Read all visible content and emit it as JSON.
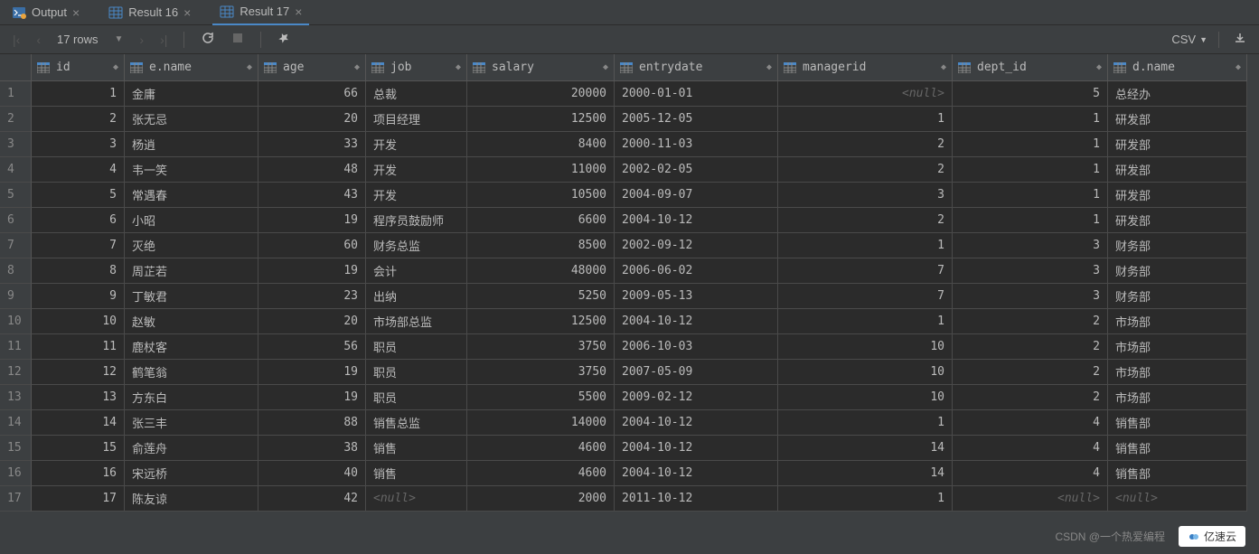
{
  "tabs": [
    {
      "label": "Output",
      "active": false,
      "type": "output"
    },
    {
      "label": "Result 16",
      "active": false,
      "type": "result"
    },
    {
      "label": "Result 17",
      "active": true,
      "type": "result"
    }
  ],
  "toolbar": {
    "rows_label": "17 rows",
    "csv_label": "CSV"
  },
  "columns": [
    {
      "name": "id",
      "align": "num"
    },
    {
      "name": "e.name",
      "align": "text"
    },
    {
      "name": "age",
      "align": "num"
    },
    {
      "name": "job",
      "align": "text"
    },
    {
      "name": "salary",
      "align": "num"
    },
    {
      "name": "entrydate",
      "align": "text"
    },
    {
      "name": "managerid",
      "align": "num"
    },
    {
      "name": "dept_id",
      "align": "num"
    },
    {
      "name": "d.name",
      "align": "text"
    }
  ],
  "rows": [
    {
      "n": "1",
      "id": "1",
      "ename": "金庸",
      "age": "66",
      "job": "总裁",
      "salary": "20000",
      "entrydate": "2000-01-01",
      "managerid": "<null>",
      "managerid_null": true,
      "dept_id": "5",
      "dname": "总经办"
    },
    {
      "n": "2",
      "id": "2",
      "ename": "张无忌",
      "age": "20",
      "job": "项目经理",
      "salary": "12500",
      "entrydate": "2005-12-05",
      "managerid": "1",
      "dept_id": "1",
      "dname": "研发部"
    },
    {
      "n": "3",
      "id": "3",
      "ename": "杨逍",
      "age": "33",
      "job": "开发",
      "salary": "8400",
      "entrydate": "2000-11-03",
      "managerid": "2",
      "dept_id": "1",
      "dname": "研发部"
    },
    {
      "n": "4",
      "id": "4",
      "ename": "韦一笑",
      "age": "48",
      "job": "开发",
      "salary": "11000",
      "entrydate": "2002-02-05",
      "managerid": "2",
      "dept_id": "1",
      "dname": "研发部"
    },
    {
      "n": "5",
      "id": "5",
      "ename": "常遇春",
      "age": "43",
      "job": "开发",
      "salary": "10500",
      "entrydate": "2004-09-07",
      "managerid": "3",
      "dept_id": "1",
      "dname": "研发部"
    },
    {
      "n": "6",
      "id": "6",
      "ename": "小昭",
      "age": "19",
      "job": "程序员鼓励师",
      "salary": "6600",
      "entrydate": "2004-10-12",
      "managerid": "2",
      "dept_id": "1",
      "dname": "研发部"
    },
    {
      "n": "7",
      "id": "7",
      "ename": "灭绝",
      "age": "60",
      "job": "财务总监",
      "salary": "8500",
      "entrydate": "2002-09-12",
      "managerid": "1",
      "dept_id": "3",
      "dname": "财务部"
    },
    {
      "n": "8",
      "id": "8",
      "ename": "周芷若",
      "age": "19",
      "job": "会计",
      "salary": "48000",
      "entrydate": "2006-06-02",
      "managerid": "7",
      "dept_id": "3",
      "dname": "财务部"
    },
    {
      "n": "9",
      "id": "9",
      "ename": "丁敏君",
      "age": "23",
      "job": "出纳",
      "salary": "5250",
      "entrydate": "2009-05-13",
      "managerid": "7",
      "dept_id": "3",
      "dname": "财务部"
    },
    {
      "n": "10",
      "id": "10",
      "ename": "赵敏",
      "age": "20",
      "job": "市场部总监",
      "salary": "12500",
      "entrydate": "2004-10-12",
      "managerid": "1",
      "dept_id": "2",
      "dname": "市场部"
    },
    {
      "n": "11",
      "id": "11",
      "ename": "鹿杖客",
      "age": "56",
      "job": "职员",
      "salary": "3750",
      "entrydate": "2006-10-03",
      "managerid": "10",
      "dept_id": "2",
      "dname": "市场部"
    },
    {
      "n": "12",
      "id": "12",
      "ename": "鹤笔翁",
      "age": "19",
      "job": "职员",
      "salary": "3750",
      "entrydate": "2007-05-09",
      "managerid": "10",
      "dept_id": "2",
      "dname": "市场部"
    },
    {
      "n": "13",
      "id": "13",
      "ename": "方东白",
      "age": "19",
      "job": "职员",
      "salary": "5500",
      "entrydate": "2009-02-12",
      "managerid": "10",
      "dept_id": "2",
      "dname": "市场部"
    },
    {
      "n": "14",
      "id": "14",
      "ename": "张三丰",
      "age": "88",
      "job": "销售总监",
      "salary": "14000",
      "entrydate": "2004-10-12",
      "managerid": "1",
      "dept_id": "4",
      "dname": "销售部"
    },
    {
      "n": "15",
      "id": "15",
      "ename": "俞莲舟",
      "age": "38",
      "job": "销售",
      "salary": "4600",
      "entrydate": "2004-10-12",
      "managerid": "14",
      "dept_id": "4",
      "dname": "销售部"
    },
    {
      "n": "16",
      "id": "16",
      "ename": "宋远桥",
      "age": "40",
      "job": "销售",
      "salary": "4600",
      "entrydate": "2004-10-12",
      "managerid": "14",
      "dept_id": "4",
      "dname": "销售部"
    },
    {
      "n": "17",
      "id": "17",
      "ename": "陈友谅",
      "age": "42",
      "job": "<null>",
      "job_null": true,
      "salary": "2000",
      "entrydate": "2011-10-12",
      "managerid": "1",
      "dept_id": "<null>",
      "dept_id_null": true,
      "dname": "<null>",
      "dname_null": true
    }
  ],
  "watermark": {
    "text": "CSDN @一个热爱编程",
    "logo": "亿速云"
  }
}
